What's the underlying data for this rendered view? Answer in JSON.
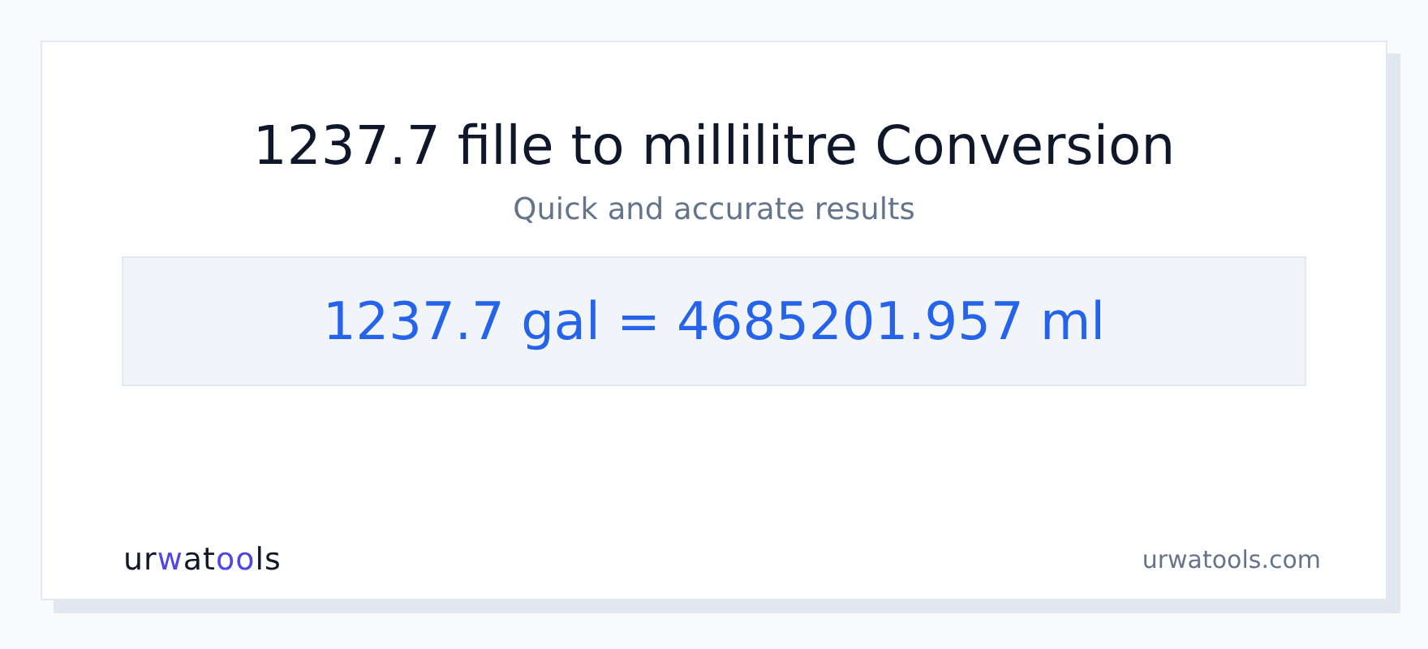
{
  "title": "1237.7 fille to millilitre Conversion",
  "subtitle": "Quick and accurate results",
  "result": "1237.7 gal = 4685201.957 ml",
  "logo": [
    {
      "text": "ur",
      "accent": false
    },
    {
      "text": "w",
      "accent": true
    },
    {
      "text": "at",
      "accent": false
    },
    {
      "text": "oo",
      "accent": true
    },
    {
      "text": "ls",
      "accent": false
    }
  ],
  "site": "urwatools.com"
}
